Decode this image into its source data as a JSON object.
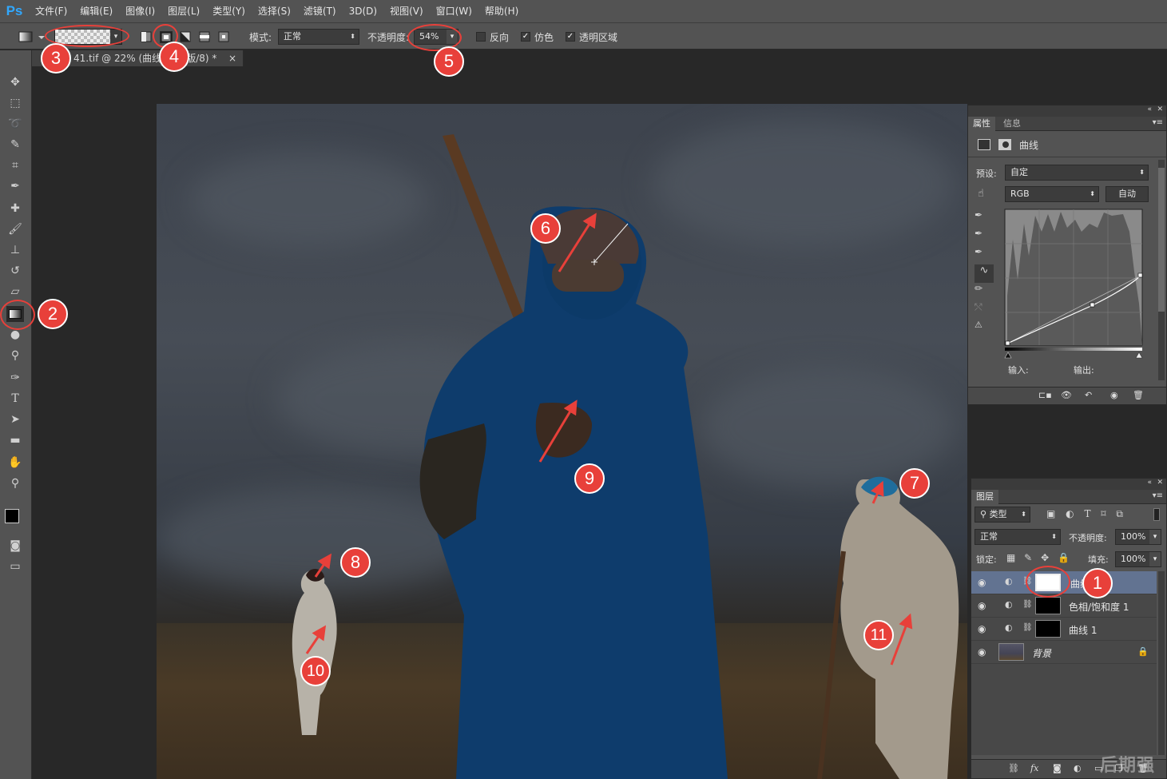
{
  "app": {
    "logo": "Ps"
  },
  "menu": [
    "文件(F)",
    "编辑(E)",
    "图像(I)",
    "图层(L)",
    "类型(Y)",
    "选择(S)",
    "滤镜(T)",
    "3D(D)",
    "视图(V)",
    "窗口(W)",
    "帮助(H)"
  ],
  "options": {
    "mode_label": "模式:",
    "mode_value": "正常",
    "opacity_label": "不透明度:",
    "opacity_value": "54%",
    "reverse_label": "反向",
    "dither_label": "仿色",
    "transparency_label": "透明区域",
    "reverse_checked": false,
    "dither_checked": true,
    "transparency_checked": true
  },
  "document": {
    "tab_title": "41.tif @ 22% (曲线 2, 蒙版/8) *",
    "close": "×"
  },
  "properties": {
    "tabs": [
      "属性",
      "信息"
    ],
    "title": "曲线",
    "preset_label": "预设:",
    "preset_value": "自定",
    "channel_value": "RGB",
    "auto_button": "自动",
    "input_label": "输入:",
    "output_label": "输出:"
  },
  "layers": {
    "tab": "图层",
    "filter_value": "类型",
    "blend_value": "正常",
    "opacity_label": "不透明度:",
    "opacity_value": "100%",
    "lock_label": "锁定:",
    "fill_label": "填充:",
    "fill_value": "100%",
    "items": [
      {
        "name": "曲线 2",
        "selected": true
      },
      {
        "name": "色相/饱和度 1",
        "selected": false
      },
      {
        "name": "曲线 1",
        "selected": false
      },
      {
        "name": "背景",
        "selected": false
      }
    ],
    "footer_icons": "fx"
  },
  "annotations": [
    "1",
    "2",
    "3",
    "4",
    "5",
    "6",
    "7",
    "8",
    "9",
    "10",
    "11"
  ],
  "watermark": "后期强",
  "colors": {
    "annotation": "#e8403a",
    "ui_bg": "#535353",
    "ps_blue": "#31a8ff"
  }
}
